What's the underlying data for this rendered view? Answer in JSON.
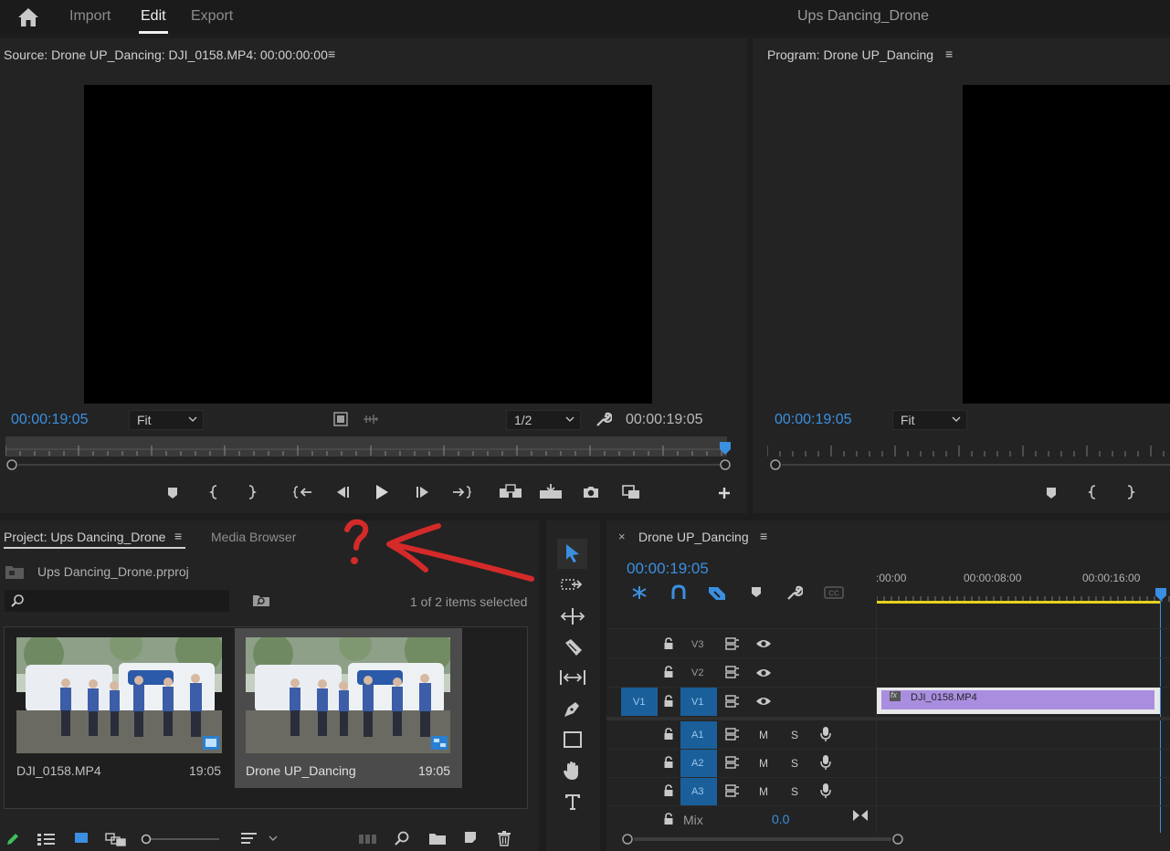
{
  "top_bar": {
    "tabs": [
      "Import",
      "Edit",
      "Export"
    ],
    "project_title": "Ups Dancing_Drone"
  },
  "source_monitor": {
    "title": "Source: Drone UP_Dancing: DJI_0158.MP4: 00:00:00:00",
    "timecode": "00:00:19:05",
    "zoom": "Fit",
    "resolution": "1/2",
    "duration": "00:00:19:05"
  },
  "program_monitor": {
    "title": "Program: Drone UP_Dancing",
    "timecode": "00:00:19:05",
    "zoom": "Fit"
  },
  "project_panel": {
    "tab_project": "Project: Ups Dancing_Drone",
    "tab_media_browser": "Media Browser",
    "file_name": "Ups Dancing_Drone.prproj",
    "search_placeholder": "",
    "selection_status": "1 of 2 items selected",
    "items": [
      {
        "name": "DJI_0158.MP4",
        "duration": "19:05",
        "selected": false
      },
      {
        "name": "Drone UP_Dancing",
        "duration": "19:05",
        "selected": true
      }
    ]
  },
  "annotation": {
    "mark": "?",
    "color": "#d42a2a"
  },
  "timeline": {
    "sequence_name": "Drone UP_Dancing",
    "timecode": "00:00:19:05",
    "ruler_labels": [
      ":00:00",
      "00:00:08:00",
      "00:00:16:00"
    ],
    "video_tracks": [
      "V3",
      "V2",
      "V1"
    ],
    "source_patch": "V1",
    "audio_tracks": [
      "A1",
      "A2",
      "A3"
    ],
    "audio_buttons": {
      "mute": "M",
      "solo": "S"
    },
    "mix_label": "Mix",
    "mix_value": "0.0",
    "clip": {
      "name": "DJI_0158.MP4",
      "fx": "fx"
    }
  },
  "colors": {
    "accent_blue": "#3b8fe0",
    "clip_purple": "#a98ee0",
    "work_area_yellow": "#e6d21e",
    "annotation_red": "#d42a2a"
  }
}
